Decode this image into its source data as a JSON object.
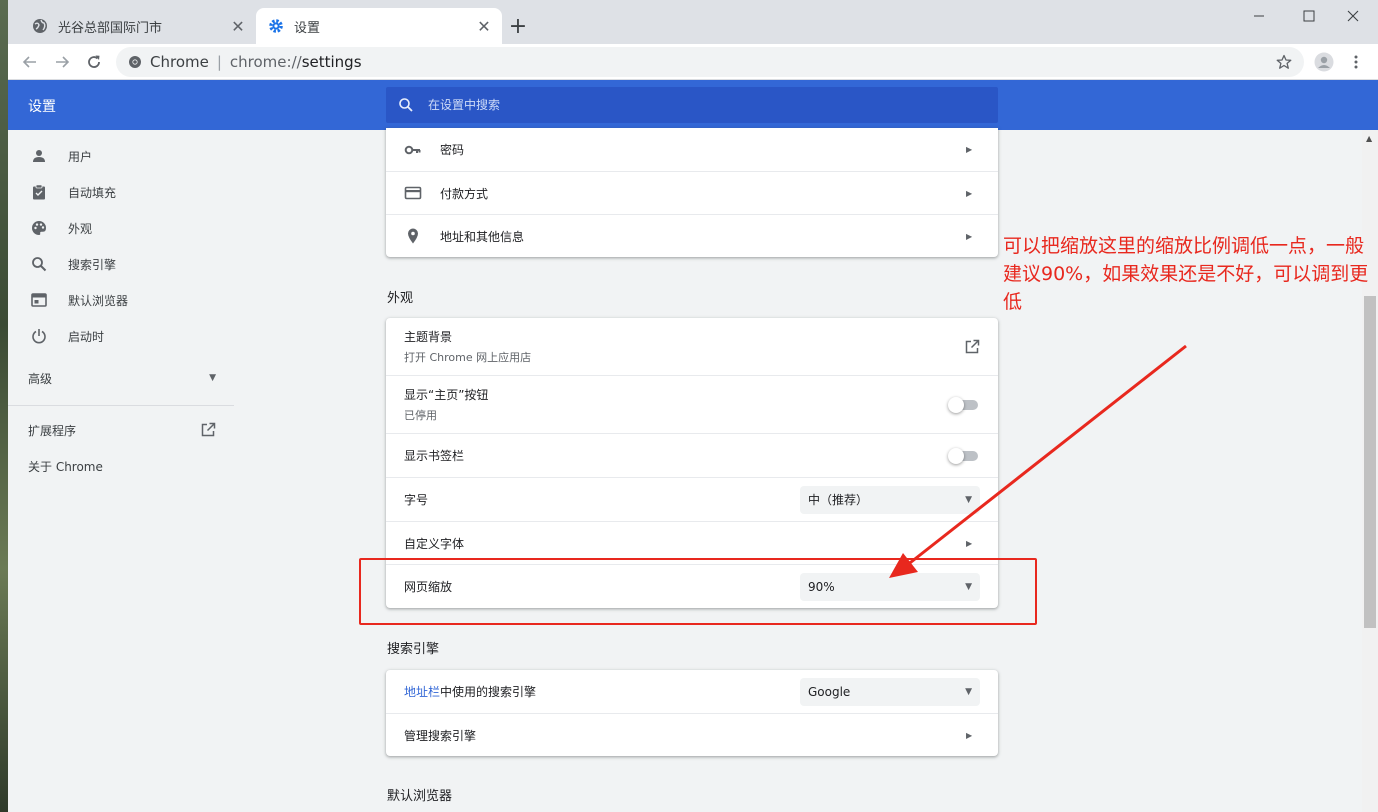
{
  "tabs": [
    {
      "label": "光谷总部国际门市",
      "icon": "globe-icon"
    },
    {
      "label": "设置",
      "icon": "gear-icon"
    }
  ],
  "address_bar": {
    "chip": "Chrome",
    "separator": "|",
    "scheme": "chrome://",
    "host": "settings"
  },
  "header": {
    "title": "设置",
    "search_placeholder": "在设置中搜索"
  },
  "sidebar": {
    "items": [
      {
        "label": "用户",
        "icon": "person-icon"
      },
      {
        "label": "自动填充",
        "icon": "clipboard-icon"
      },
      {
        "label": "外观",
        "icon": "palette-icon"
      },
      {
        "label": "搜索引擎",
        "icon": "search-icon"
      },
      {
        "label": "默认浏览器",
        "icon": "browser-icon"
      },
      {
        "label": "启动时",
        "icon": "power-icon"
      }
    ],
    "advanced": "高级",
    "extensions": "扩展程序",
    "about": "关于 Chrome"
  },
  "autofill_card": {
    "rows": [
      {
        "label": "密码",
        "icon": "key-icon"
      },
      {
        "label": "付款方式",
        "icon": "credit-card-icon"
      },
      {
        "label": "地址和其他信息",
        "icon": "location-pin-icon"
      }
    ]
  },
  "appearance": {
    "section_title": "外观",
    "theme": {
      "label": "主题背景",
      "sub": "打开 Chrome 网上应用店"
    },
    "home_button": {
      "label": "显示“主页”按钮",
      "sub": "已停用",
      "enabled": false
    },
    "bookmarks_bar": {
      "label": "显示书签栏",
      "enabled": false
    },
    "font_size": {
      "label": "字号",
      "value": "中（推荐）"
    },
    "custom_fonts": {
      "label": "自定义字体"
    },
    "page_zoom": {
      "label": "网页缩放",
      "value": "90%"
    }
  },
  "search_engine": {
    "section_title": "搜索引擎",
    "used_in_prefix": "地址栏",
    "used_in_suffix": "中使用的搜索引擎",
    "engine_value": "Google",
    "manage": "管理搜索引擎"
  },
  "default_browser": {
    "section_title": "默认浏览器"
  },
  "annotation": {
    "text": "可以把缩放这里的缩放比例调低一点，一般建议90%，如果效果还是不好，可以调到更低",
    "color": "#e8281e"
  },
  "colors": {
    "header_blue": "#3367d6",
    "search_blue": "#2a56c6",
    "link_blue": "#3367d6"
  }
}
